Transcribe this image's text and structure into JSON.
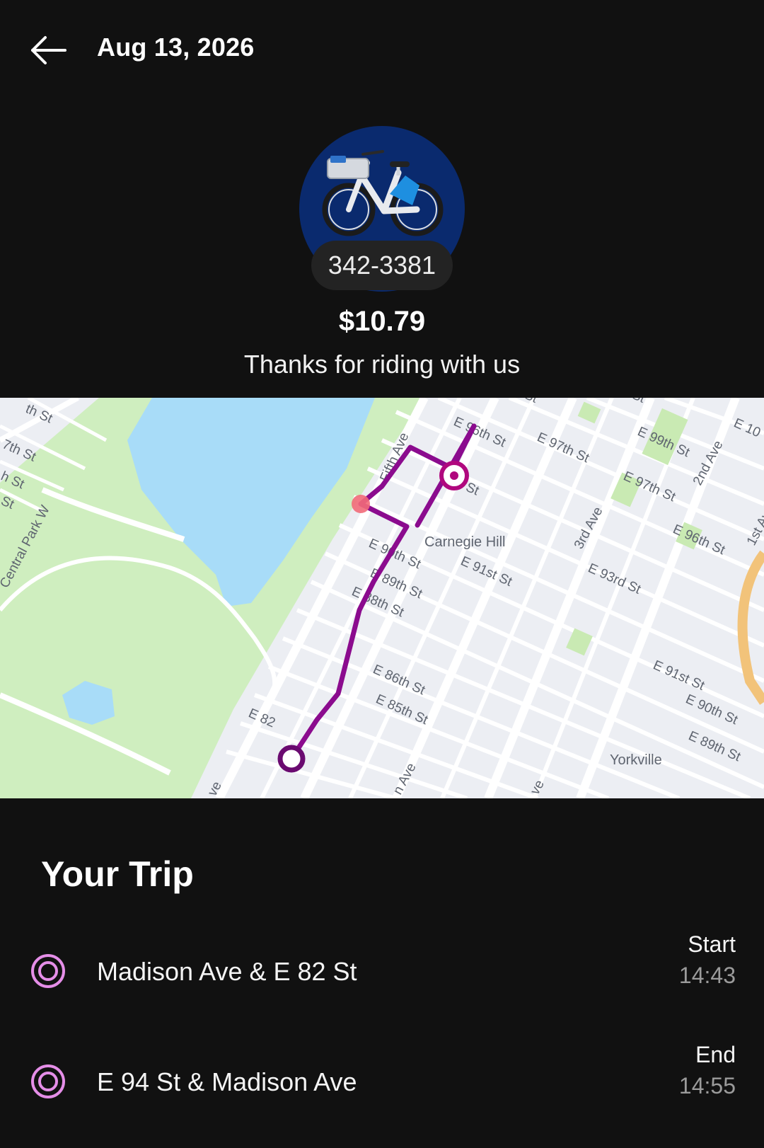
{
  "header": {
    "back_icon": "arrow-left-icon",
    "date": "Aug 13, 2026"
  },
  "ride": {
    "bike_icon": "citibike-ebike-icon",
    "bike_id": "342-3381",
    "price": "$10.79",
    "message": "Thanks for riding with us"
  },
  "map": {
    "neighborhoods": [
      "Carnegie Hill",
      "Yorkville"
    ],
    "streets": [
      "th St",
      "7th St",
      "h St",
      "St",
      "Central Park W",
      "Fifth Ave",
      "E 96th St",
      "E 97th St",
      "E 99th St",
      "E 97th St",
      "2nd Ave",
      "E 10",
      "1st Ave",
      "3rd Ave",
      "E 96th St",
      "E 93rd St",
      "E 91st St",
      "E 90th St",
      "E 89th St",
      "E 88th St",
      "E 86th St",
      "E 85th St",
      "E 82",
      "E 91st St",
      "E 90th St",
      "E 89th St",
      "ve",
      "n Ave",
      "ve",
      "th St",
      "St",
      "St"
    ],
    "route_color": "#8b0b8e",
    "park_color": "#cfeebf",
    "water_color": "#a8dcf8"
  },
  "trip": {
    "title": "Your Trip",
    "stops": [
      {
        "icon": "location-ring-icon",
        "address": "Madison Ave & E 82 St",
        "kind": "Start",
        "time": "14:43"
      },
      {
        "icon": "location-ring-icon",
        "address": "E 94 St & Madison Ave",
        "kind": "End",
        "time": "14:55"
      }
    ],
    "accent_color": "#e58ee8"
  }
}
